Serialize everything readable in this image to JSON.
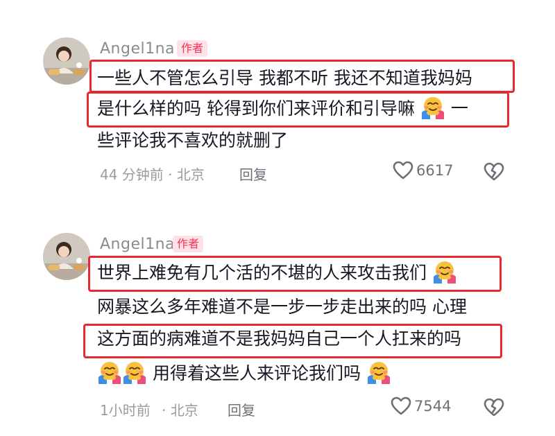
{
  "comments": [
    {
      "username": "Angel1na",
      "badge": "作者",
      "lines": [
        "一些人不管怎么引导 我都不听 我还不知道我妈妈",
        "是什么样的吗 轮得到你们来评价和引导嘛",
        "一",
        "些评论我不喜欢的就删了"
      ],
      "time": "44 分钟前",
      "separator": "·",
      "location": "北京",
      "reply_label": "回复",
      "like_count": "6617"
    },
    {
      "username": "Angel1na",
      "badge": "作者",
      "lines": [
        "世界上难免有几个活的不堪的人来攻击我们",
        "网暴这么多年难道不是一步一步走出来的吗 心理",
        "这方面的病难道不是我妈妈自己一个人扛来的吗",
        "用得着这些人来评论我们吗"
      ],
      "time": "1小时前",
      "separator": "·",
      "location": "北京",
      "reply_label": "回复",
      "like_count": "7544"
    }
  ],
  "colors": {
    "highlight_box": "#e8282c",
    "badge_text": "#fe2c55",
    "badge_bg": "#fde3e7",
    "username": "#8a8b91",
    "body_text": "#161823",
    "meta_text": "#9a9ba1"
  },
  "icons": {
    "emoji": "hug-emoji-icon",
    "like": "heart-outline-icon",
    "dislike": "broken-heart-icon"
  }
}
